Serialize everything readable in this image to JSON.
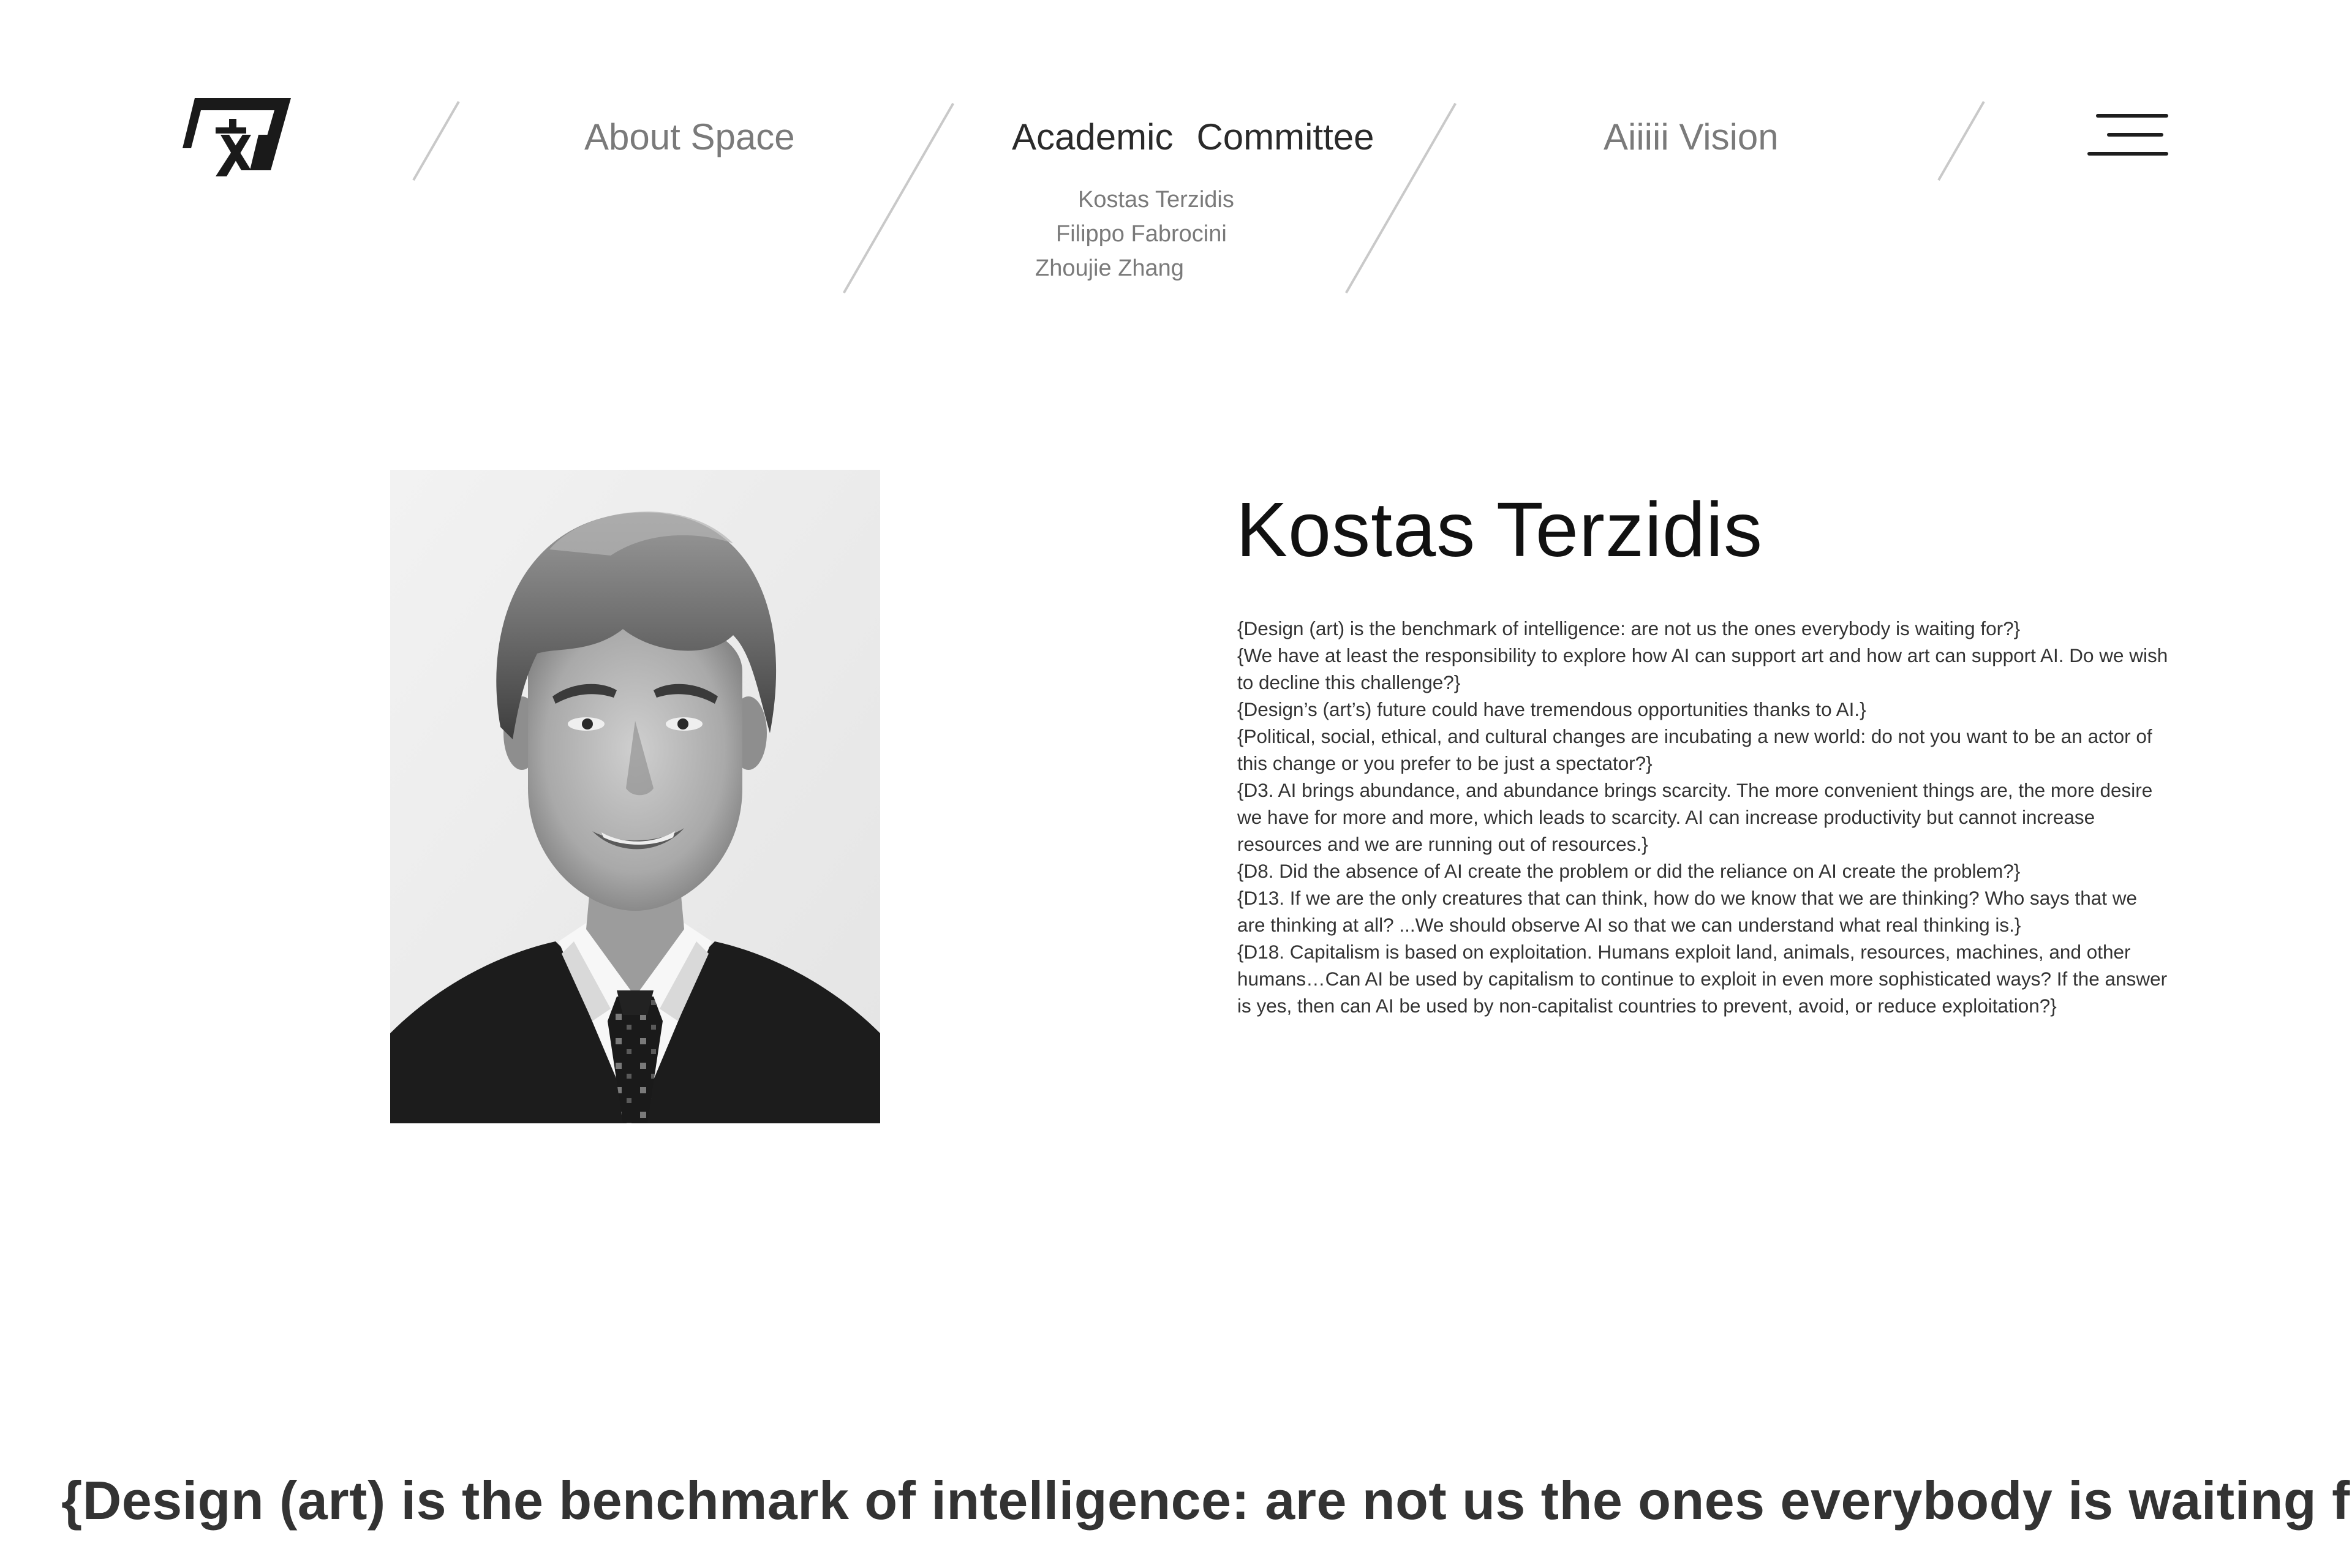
{
  "header": {
    "logo_icon": "ai-space-logo-icon",
    "nav": [
      {
        "label": "About Space"
      },
      {
        "label_words": [
          "Academic",
          "Committee"
        ]
      },
      {
        "label": "Aiiiii Vision"
      }
    ],
    "submenu": [
      "Kostas Terzidis",
      "Filippo Fabrocini",
      "Zhoujie Zhang"
    ],
    "menu_icon": "hamburger-menu-icon"
  },
  "profile": {
    "photo_icon": "portrait-photo",
    "name": "Kostas Terzidis",
    "bio": [
      "{Design (art) is the benchmark of intelligence: are not us the ones everybody is waiting for?}",
      "{We have at least the responsibility to explore how AI can support art and how art can support AI. Do we wish to decline this challenge?}",
      "{Design’s (art’s) future could have tremendous opportunities thanks to AI.}",
      "{Political, social, ethical, and cultural changes are incubating a new world: do not you want to be an actor of this change or you prefer to be just a spectator?}",
      "{D3. AI brings abundance, and abundance brings scarcity. The more convenient things are, the more desire we have for more and more, which leads to scarcity. AI can increase productivity but cannot increase resources and we are running out of resources.}",
      "{D8. Did the absence of AI create the problem or did the reliance on AI create the problem?}",
      "{D13. If we are the only creatures that can think, how do we know that we are thinking? Who says that we are thinking at all? ...We should observe AI so that we can understand what real thinking is.}",
      "{D18. Capitalism is based on exploitation. Humans exploit land, animals, resources, machines, and other humans…Can AI be used by capitalism to continue to exploit in even more sophisticated ways? If the answer is yes, then can AI be used by non-capitalist countries to prevent, avoid, or reduce exploitation?}"
    ]
  },
  "marquee": {
    "text": "{Design (art) is the benchmark of intelligence: are not us the ones everybody is waiting f"
  }
}
